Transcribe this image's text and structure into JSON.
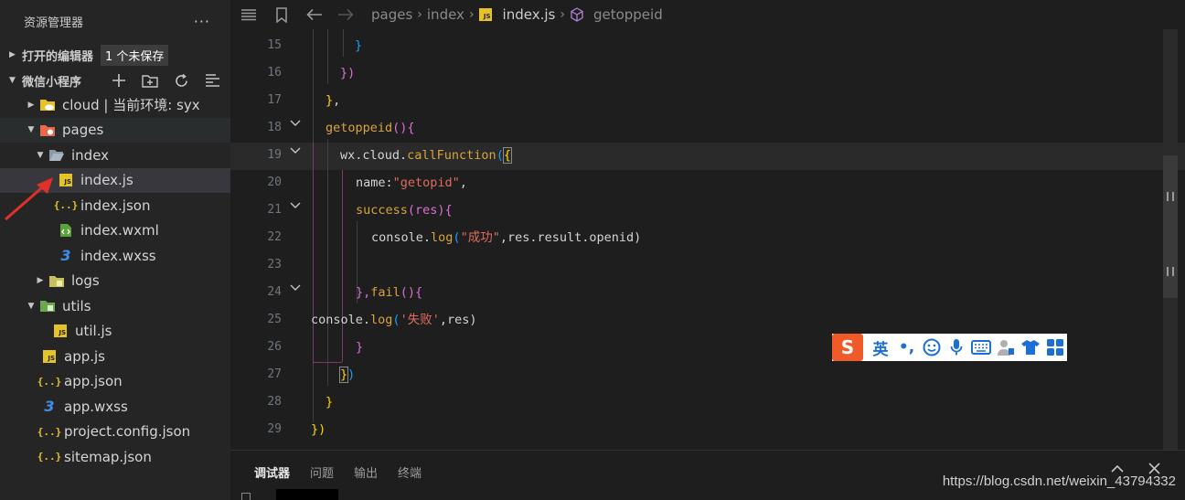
{
  "sidebar": {
    "title": "资源管理器",
    "more": "···",
    "open_editors": {
      "label": "打开的编辑器",
      "badge": "1 个未保存"
    },
    "project": {
      "label": "微信小程序"
    },
    "tree": [
      {
        "label": "cloud | 当前环境: syx",
        "type": "folder-cloud"
      },
      {
        "label": "pages",
        "type": "folder-pages"
      },
      {
        "label": "index",
        "type": "folder-open"
      },
      {
        "label": "index.js",
        "type": "js"
      },
      {
        "label": "index.json",
        "type": "json"
      },
      {
        "label": "index.wxml",
        "type": "wxml"
      },
      {
        "label": "index.wxss",
        "type": "wxss"
      },
      {
        "label": "logs",
        "type": "folder"
      },
      {
        "label": "utils",
        "type": "folder-utils"
      },
      {
        "label": "util.js",
        "type": "js"
      },
      {
        "label": "app.js",
        "type": "js"
      },
      {
        "label": "app.json",
        "type": "json"
      },
      {
        "label": "app.wxss",
        "type": "wxss"
      },
      {
        "label": "project.config.json",
        "type": "json"
      },
      {
        "label": "sitemap.json",
        "type": "json"
      }
    ]
  },
  "breadcrumb": {
    "items": [
      "pages",
      "index",
      "index.js",
      "getoppeid"
    ],
    "js_badge": "JS"
  },
  "editor": {
    "line_numbers": [
      "15",
      "16",
      "17",
      "18",
      "19",
      "20",
      "21",
      "22",
      "23",
      "24",
      "25",
      "26",
      "27",
      "28",
      "29"
    ],
    "lines": {
      "l15": "}",
      "l16": "})",
      "l17_a": "}",
      "l17_b": ",",
      "l18_a": "getoppeid",
      "l18_b": "(){",
      "l19_a": "wx.cloud.",
      "l19_b": "callFunction",
      "l19_c": "(",
      "l19_d": "{",
      "l20_a": "name:",
      "l20_b": "\"getopid\"",
      "l20_c": ",",
      "l21_a": "success",
      "l21_b": "(res){",
      "l22_a": "console.",
      "l22_b": "log",
      "l22_c": "(",
      "l22_d": "\"成功\"",
      "l22_e": ",res.result.openid)",
      "l24_a": "},",
      "l24_b": "fail",
      "l24_c": "(){",
      "l25_a": "console.",
      "l25_b": "log",
      "l25_c": "(",
      "l25_d": "'失败'",
      "l25_e": ",res)",
      "l26": "}",
      "l27_a": "}",
      "l27_b": ")",
      "l28": "}",
      "l29": "})"
    }
  },
  "ime": {
    "logo": "S",
    "mode": "英",
    "punct": "•,"
  },
  "panel": {
    "tabs": [
      "调试器",
      "问题",
      "输出",
      "终端"
    ]
  },
  "watermark": "https://blog.csdn.net/weixin_43794332",
  "colors": {
    "sidebar_bg": "#252526",
    "editor_bg": "#1e1e1e",
    "selection": "#37373d",
    "js_yellow": "#e6c229",
    "css_blue": "#3f8ee6",
    "function": "#d8a53e",
    "string": "#e06c5d",
    "ime_orange": "#f05a28",
    "ime_blue": "#1b6fd6",
    "annotation_arrow": "#e0302a"
  }
}
